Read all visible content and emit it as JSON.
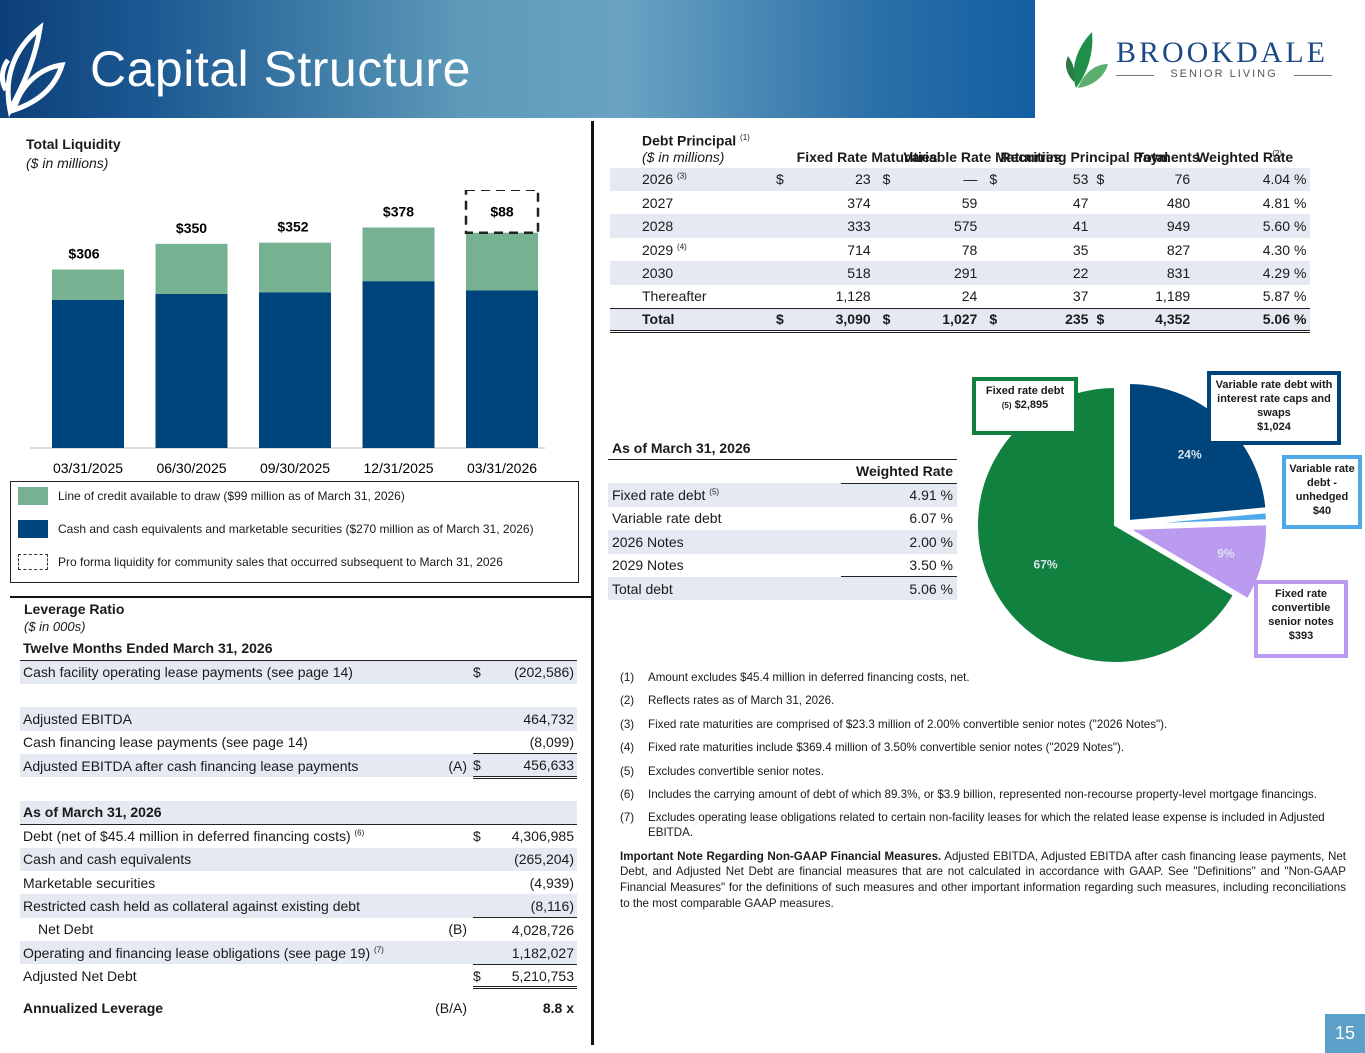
{
  "header": {
    "title": "Capital Structure",
    "logo_name": "BROOKDALE",
    "logo_sub": "SENIOR LIVING"
  },
  "colors": {
    "navy": "#00447c",
    "green": "#76b192",
    "dark_green": "#118140",
    "purple": "#bb9bf0",
    "light_blue": "#4fa9e9",
    "header_blue": "#135ea2"
  },
  "liquidity": {
    "title": "Total Liquidity",
    "subtitle": "($ in millions)",
    "legend": [
      "Line of credit available to draw ($99 million as of March 31, 2026)",
      "Cash and cash equivalents and marketable securities ($270 million as of March 31, 2026)",
      "Pro forma liquidity for community sales that occurred subsequent to March 31, 2026"
    ]
  },
  "chart_data": {
    "type": "bar",
    "stacked": true,
    "categories": [
      "03/31/2025",
      "06/30/2025",
      "09/30/2025",
      "12/31/2025",
      "03/31/2026"
    ],
    "series": [
      {
        "values": [
          254,
          264,
          267,
          286,
          270
        ],
        "color": "#00447c"
      },
      {
        "values": [
          52,
          86,
          85,
          92,
          99
        ],
        "color": "#76b192"
      },
      {
        "values": [
          0,
          0,
          0,
          0,
          88
        ],
        "color": "none",
        "dashed": true
      }
    ],
    "totals": [
      "$306",
      "$350",
      "$352",
      "$378",
      "$457"
    ],
    "pro_forma_label": "$88",
    "ylim": [
      0,
      460
    ]
  },
  "leverage": {
    "title": "Leverage Ratio",
    "subtitle": "($ in 000s)",
    "header": "Twelve Months Ended March 31, 2026",
    "rows1": [
      {
        "label": "Cash facility operating lease payments (see page 14)",
        "dollar": "$",
        "value": "(202,586)"
      }
    ],
    "rows2": [
      {
        "label": "Adjusted EBITDA",
        "value": "464,732"
      },
      {
        "label": "Cash financing lease payments (see page 14)",
        "value": "(8,099)"
      },
      {
        "label": "Adjusted EBITDA after cash financing lease payments",
        "mark": "(A)",
        "dollar": "$",
        "value": "456,633"
      }
    ],
    "as_of": "As of March 31, 2026",
    "rows3": [
      {
        "label": "Debt (net of $45.4 million in deferred financing costs)",
        "sup": "(6)",
        "dollar": "$",
        "value": "4,306,985"
      },
      {
        "label": "Cash and cash equivalents",
        "value": "(265,204)"
      },
      {
        "label": "Marketable securities",
        "value": "(4,939)"
      },
      {
        "label": "Restricted cash held as collateral against existing debt",
        "value": "(8,116)"
      },
      {
        "label": "Net Debt",
        "mark": "(B)",
        "value": "4,028,726"
      },
      {
        "label": "Operating and financing lease obligations (see page 19)",
        "sup": "(7)",
        "value": "1,182,027"
      },
      {
        "label": "Adjusted Net Debt",
        "dollar": "$",
        "value": "5,210,753"
      }
    ],
    "annualized_label": "Annualized Leverage",
    "annualized_mark": "(B/A)",
    "annualized_value": "8.8 x"
  },
  "debt": {
    "title": "Debt Principal",
    "title_sup": "(1)",
    "subtitle": "($ in millions)",
    "columns": [
      "Fixed Rate Maturities",
      "Variable Rate Maturities",
      "Recurring Principal Payments",
      "Total",
      "Weighted Rate"
    ],
    "rate_sup": "(2)",
    "rows": [
      {
        "year": "2026",
        "sup": "(3)",
        "fixed": "23",
        "variable": "—",
        "recurring": "53",
        "total": "76",
        "rate": "4.04"
      },
      {
        "year": "2027",
        "sup": "",
        "fixed": "374",
        "variable": "59",
        "recurring": "47",
        "total": "480",
        "rate": "4.81"
      },
      {
        "year": "2028",
        "sup": "",
        "fixed": "333",
        "variable": "575",
        "recurring": "41",
        "total": "949",
        "rate": "5.60"
      },
      {
        "year": "2029",
        "sup": "(4)",
        "fixed": "714",
        "variable": "78",
        "recurring": "35",
        "total": "827",
        "rate": "4.30"
      },
      {
        "year": "2030",
        "sup": "",
        "fixed": "518",
        "variable": "291",
        "recurring": "22",
        "total": "831",
        "rate": "4.29"
      },
      {
        "year": "Thereafter",
        "sup": "",
        "fixed": "1,128",
        "variable": "24",
        "recurring": "37",
        "total": "1,189",
        "rate": "5.87"
      }
    ],
    "total_row": {
      "year": "Total",
      "fixed": "3,090",
      "variable": "1,027",
      "recurring": "235",
      "total": "4,352",
      "rate": "5.06"
    }
  },
  "weighted_rate": {
    "as_of": "As of March 31, 2026",
    "header": "Weighted Rate",
    "rows": [
      {
        "label": "Fixed rate debt",
        "sup": "(5)",
        "value": "4.91 %"
      },
      {
        "label": "Variable rate debt",
        "sup": "",
        "value": "6.07 %"
      },
      {
        "label": "2026 Notes",
        "sup": "",
        "value": "2.00 %"
      },
      {
        "label": "2029 Notes",
        "sup": "",
        "value": "3.50 %"
      },
      {
        "label": "Total debt",
        "sup": "",
        "value": "5.06 %"
      }
    ]
  },
  "pie": {
    "slices": [
      {
        "name": "Fixed rate debt",
        "sup": "(5)",
        "amount": "$2,895",
        "value": 2895,
        "pct": "67%",
        "color": "#118140"
      },
      {
        "name": "Variable rate debt with interest rate caps and swaps",
        "amount": "$1,024",
        "value": 1024,
        "pct": "24%",
        "color": "#00447c"
      },
      {
        "name": "Variable rate debt - unhedged",
        "amount": "$40",
        "value": 40,
        "pct": "",
        "color": "#4fa9e9"
      },
      {
        "name": "Fixed rate convertible senior notes",
        "amount": "$393",
        "value": 393,
        "pct": "9%",
        "color": "#bb9bf0"
      }
    ]
  },
  "footnotes": [
    {
      "num": "(1)",
      "text": "Amount excludes $45.4 million in deferred financing costs, net."
    },
    {
      "num": "(2)",
      "text": "Reflects rates as of March 31, 2026."
    },
    {
      "num": "(3)",
      "text": "Fixed rate maturities are comprised of $23.3 million of 2.00% convertible senior notes (\"2026 Notes\")."
    },
    {
      "num": "(4)",
      "text": "Fixed rate maturities include $369.4 million of 3.50% convertible senior notes (\"2029 Notes\")."
    },
    {
      "num": "(5)",
      "text": "Excludes convertible senior notes."
    },
    {
      "num": "(6)",
      "text": "Includes the carrying amount of debt of which 89.3%, or $3.9 billion, represented non-recourse property-level mortgage financings."
    },
    {
      "num": "(7)",
      "text": "Excludes operating lease obligations related to certain non-facility leases for which the related lease expense is included in Adjusted EBITDA."
    }
  ],
  "important_note": {
    "title": "Important Note Regarding Non-GAAP Financial Measures.",
    "text": " Adjusted EBITDA, Adjusted EBITDA after cash financing lease payments, Net Debt, and Adjusted Net Debt are financial measures that are not calculated in accordance with GAAP. See \"Definitions\" and \"Non-GAAP Financial Measures\" for the definitions of such measures and other important information regarding such measures, including reconciliations to the most comparable GAAP measures."
  },
  "page_number": "15"
}
